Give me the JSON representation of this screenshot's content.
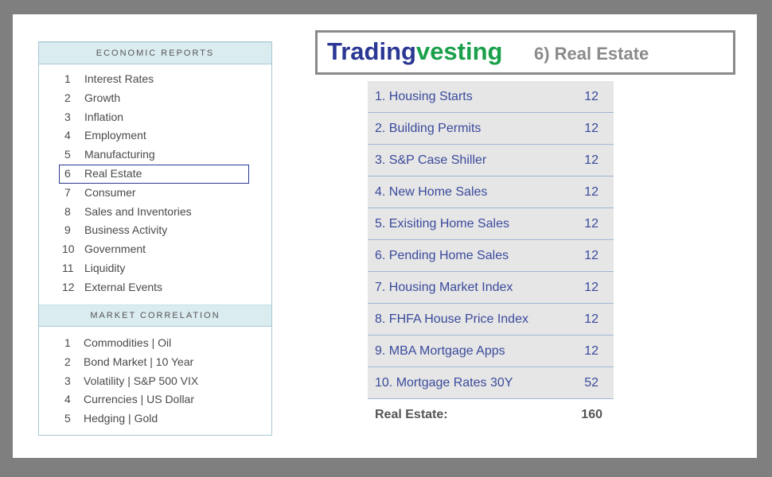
{
  "sidebar": {
    "economic_title": "ECONOMIC REPORTS",
    "economic_reports": [
      {
        "num": "1",
        "label": "Interest Rates"
      },
      {
        "num": "2",
        "label": "Growth"
      },
      {
        "num": "3",
        "label": "Inflation"
      },
      {
        "num": "4",
        "label": "Employment"
      },
      {
        "num": "5",
        "label": "Manufacturing"
      },
      {
        "num": "6",
        "label": "Real Estate"
      },
      {
        "num": "7",
        "label": "Consumer"
      },
      {
        "num": "8",
        "label": "Sales and Inventories"
      },
      {
        "num": "9",
        "label": "Business Activity"
      },
      {
        "num": "10",
        "label": "Government"
      },
      {
        "num": "11",
        "label": "Liquidity"
      },
      {
        "num": "12",
        "label": "External Events"
      }
    ],
    "selected_index": 6,
    "correlation_title": "MARKET CORRELATION",
    "market_correlation": [
      {
        "num": "1",
        "label": "Commodities | Oil"
      },
      {
        "num": "2",
        "label": "Bond Market | 10 Year"
      },
      {
        "num": "3",
        "label": "Volatility | S&P 500 VIX"
      },
      {
        "num": "4",
        "label": "Currencies | US Dollar"
      },
      {
        "num": "5",
        "label": "Hedging | Gold"
      }
    ]
  },
  "header": {
    "brand_part1": "Trading",
    "brand_part2": "vesting",
    "section_title": "6) Real Estate"
  },
  "table": {
    "rows": [
      {
        "name": "1. Housing Starts",
        "value": "12"
      },
      {
        "name": "2. Building Permits",
        "value": "12"
      },
      {
        "name": "3. S&P Case Shiller",
        "value": "12"
      },
      {
        "name": "4. New Home Sales",
        "value": "12"
      },
      {
        "name": "5. Exisiting Home Sales",
        "value": "12"
      },
      {
        "name": "6. Pending Home Sales",
        "value": "12"
      },
      {
        "name": "7. Housing Market Index",
        "value": "12"
      },
      {
        "name": "8. FHFA House Price Index",
        "value": "12"
      },
      {
        "name": "9. MBA Mortgage Apps",
        "value": "12"
      },
      {
        "name": "10. Mortgage Rates 30Y",
        "value": "52"
      }
    ],
    "total_label": "Real Estate:",
    "total_value": "160"
  },
  "colors": {
    "brand_blue": "#2a3793",
    "brand_green": "#1aa04a",
    "row_text": "#3a4a9c",
    "row_bg": "#e6e6e6",
    "panel_head_bg": "#dbecf1"
  }
}
